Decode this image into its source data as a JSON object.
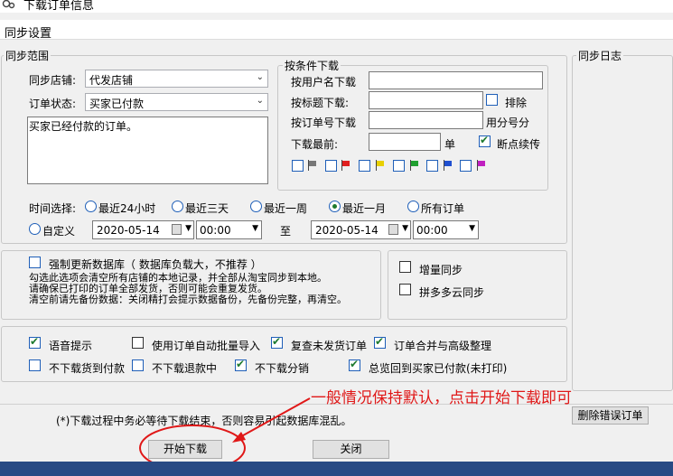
{
  "window": {
    "title": "下载订单信息"
  },
  "menu": {
    "sync_settings": "同步设置"
  },
  "sync_range": {
    "legend": "同步范围",
    "store_label": "同步店铺:",
    "store_value": "代发店铺",
    "status_label": "订单状态:",
    "status_value": "买家已付款",
    "status_desc": "买家已经付款的订单。"
  },
  "conditions": {
    "legend": "按条件下载",
    "by_user": "按用户名下载",
    "by_title": "按标题下载:",
    "exclude": "排除",
    "by_order": "按订单号下载",
    "split_hint": "用分号分",
    "recent": "下载最前:",
    "unit": "单",
    "resume": "断点续传"
  },
  "flag_colors": [
    "#777777",
    "#e02020",
    "#e8d000",
    "#20a030",
    "#2050d0",
    "#c020c0"
  ],
  "time": {
    "label": "时间选择:",
    "options": [
      "最近24小时",
      "最近三天",
      "最近一周",
      "最近一月",
      "所有订单"
    ],
    "custom": "自定义",
    "start_date": "2020-05-14",
    "start_time": "00:00",
    "to": "至",
    "end_date": "2020-05-14",
    "end_time": "00:00"
  },
  "force": {
    "label": "强制更新数据库（ 数据库负载大，不推荐 ）",
    "note1": "勾选此选项会清空所有店铺的本地记录，并全部从淘宝同步到本地。",
    "note2": "请确保已打印的订单全部发货，否则可能会重复发货。",
    "note3": "清空前请先备份数据：关闭精打会提示数据备份，先备份完整，再清空。"
  },
  "sync_opts": {
    "incremental": "增量同步",
    "pdd": "拼多多云同步"
  },
  "options": {
    "voice": "语音提示",
    "auto_import": "使用订单自动批量导入",
    "review": "复查未发货订单",
    "merge": "订单合并与高级整理",
    "no_shipped": "不下载货到付款",
    "no_refund": "不下载退款中",
    "no_split": "不下载分销",
    "overview": "总览回到买家已付款(未打印)"
  },
  "sync_log": {
    "legend": "同步日志"
  },
  "footer": {
    "warning": "(*)下载过程中务必等待下载结束，否则容易引起数据库混乱。",
    "delete_errors": "删除错误订单",
    "start": "开始下载",
    "close": "关闭"
  },
  "annotation": "一般情况保持默认，点击开始下载即可"
}
